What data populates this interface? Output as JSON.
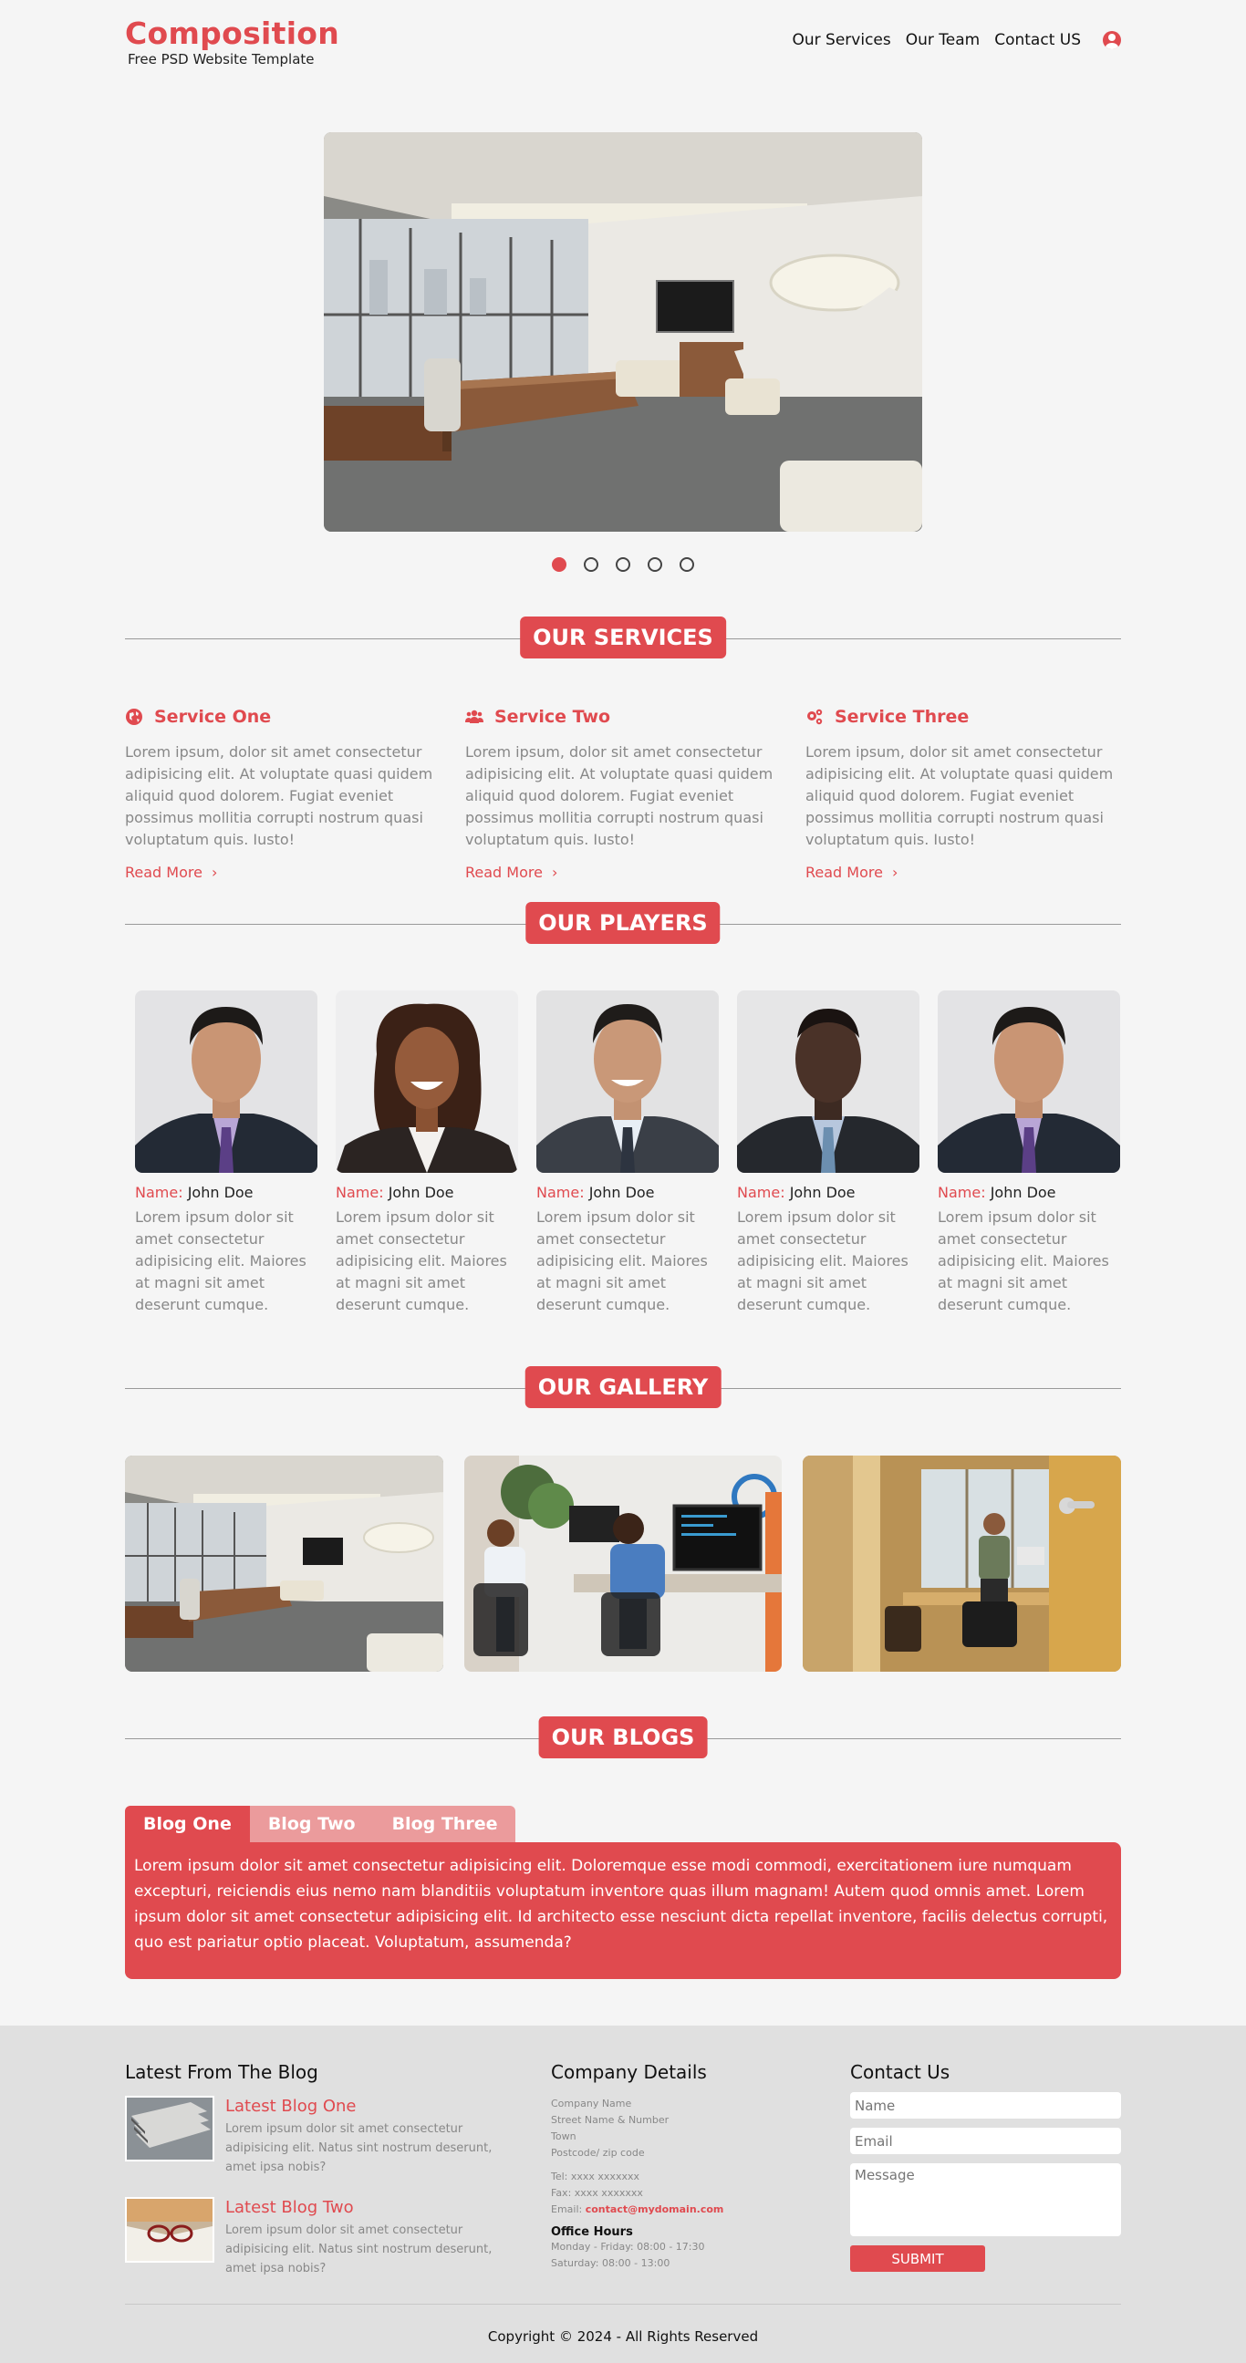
{
  "brand": {
    "title": "Composition",
    "subtitle": "Free PSD Website Template"
  },
  "nav": {
    "items": [
      "Our Services",
      "Our Team",
      "Contact US"
    ],
    "user_icon": "user-circle-icon"
  },
  "slider": {
    "dots": 5,
    "active_index": 0
  },
  "sections": {
    "services": "OUR SERVICES",
    "players": "OUR PLAYERS",
    "gallery": "OUR GALLERY",
    "blogs": "OUR BLOGS"
  },
  "services": [
    {
      "icon": "globe-icon",
      "title": "Service One",
      "text": "Lorem ipsum, dolor sit amet consectetur adipisicing elit. At voluptate quasi quidem aliquid quod dolorem. Fugiat eveniet possimus mollitia corrupti nostrum quasi voluptatum quis. Iusto!",
      "link": "Read More"
    },
    {
      "icon": "users-icon",
      "title": "Service Two",
      "text": "Lorem ipsum, dolor sit amet consectetur adipisicing elit. At voluptate quasi quidem aliquid quod dolorem. Fugiat eveniet possimus mollitia corrupti nostrum quasi voluptatum quis. Iusto!",
      "link": "Read More"
    },
    {
      "icon": "gears-icon",
      "title": "Service Three",
      "text": "Lorem ipsum, dolor sit amet consectetur adipisicing elit. At voluptate quasi quidem aliquid quod dolorem. Fugiat eveniet possimus mollitia corrupti nostrum quasi voluptatum quis. Iusto!",
      "link": "Read More"
    }
  ],
  "players": [
    {
      "label": "Name:",
      "name": "John Doe",
      "text": "Lorem ipsum dolor sit amet consectetur adipisicing elit. Maiores at magni sit amet deserunt cumque."
    },
    {
      "label": "Name:",
      "name": "John Doe",
      "text": "Lorem ipsum dolor sit amet consectetur adipisicing elit. Maiores at magni sit amet deserunt cumque."
    },
    {
      "label": "Name:",
      "name": "John Doe",
      "text": "Lorem ipsum dolor sit amet consectetur adipisicing elit. Maiores at magni sit amet deserunt cumque."
    },
    {
      "label": "Name:",
      "name": "John Doe",
      "text": "Lorem ipsum dolor sit amet consectetur adipisicing elit. Maiores at magni sit amet deserunt cumque."
    },
    {
      "label": "Name:",
      "name": "John Doe",
      "text": "Lorem ipsum dolor sit amet consectetur adipisicing elit. Maiores at magni sit amet deserunt cumque."
    }
  ],
  "blogs": {
    "tabs": [
      "Blog One",
      "Blog Two",
      "Blog Three"
    ],
    "active_tab": 0,
    "content": "Lorem ipsum dolor sit amet consectetur adipisicing elit. Doloremque esse modi commodi, exercitationem iure numquam excepturi, reiciendis eius nemo nam blanditiis voluptatum inventore quas illum magnam! Autem quod omnis amet. Lorem ipsum dolor sit amet consectetur adipisicing elit. Id architecto esse nesciunt dicta repellat inventore, facilis delectus corrupti, quo est pariatur optio placeat. Voluptatum, assumenda?"
  },
  "footer": {
    "blog_title": "Latest From The Blog",
    "posts": [
      {
        "title": "Latest Blog One",
        "text": "Lorem ipsum dolor sit amet consectetur adipisicing elit. Natus sint nostrum deserunt, amet ipsa nobis?"
      },
      {
        "title": "Latest Blog Two",
        "text": "Lorem ipsum dolor sit amet consectetur adipisicing elit. Natus sint nostrum deserunt, amet ipsa nobis?"
      }
    ],
    "company_title": "Company Details",
    "company_lines": [
      "Company Name",
      "Street Name & Number",
      "Town",
      "Postcode/ zip code"
    ],
    "tel": "Tel: xxxx xxxxxxx",
    "fax": "Fax: xxxx xxxxxxx",
    "email_label": "Email: ",
    "email": "contact@mydomain.com",
    "hours_title": "Office Hours",
    "hours": [
      "Monday - Friday: 08:00 - 17:30",
      "Saturday: 08:00 - 13:00"
    ],
    "contact_title": "Contact Us",
    "name_placeholder": "Name",
    "email_placeholder": "Email",
    "message_placeholder": "Message",
    "submit": "SUBMIT",
    "copyright": "Copyright © 2024 - All Rights Reserved"
  }
}
